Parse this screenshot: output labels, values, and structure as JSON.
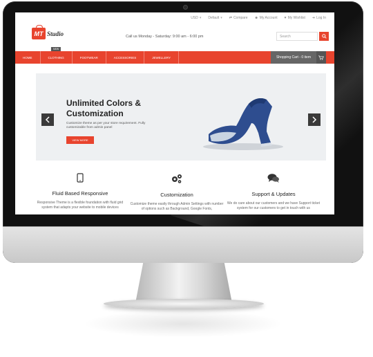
{
  "topbar": {
    "currency": "USD",
    "store": "Default",
    "links": [
      "Compare",
      "My Account",
      "My Wishlist",
      "Log In"
    ]
  },
  "header": {
    "logo_mark": "MT",
    "logo_text": "Studio",
    "callus": "Call us Monday - Saturday: 9:00 am - 6:00 pm",
    "search_placeholder": "Search"
  },
  "nav": {
    "items": [
      "HOME",
      "CLOTHING",
      "FOOTWEAR",
      "ACCESSORIES",
      "JEWELLERY"
    ],
    "badge": "NEW",
    "cart_label": "Shopping Cart - 0 item"
  },
  "hero": {
    "title": "Unlimited Colors & Customization",
    "text": "Customize theme as per your store requirement. Fully customizable from admin panel",
    "button": "VIEW MORE"
  },
  "features": [
    {
      "title": "Fluid Based Responsive",
      "text": "Responsive Theme is a flexible foundation with fluid grid system that adapts your website to mobile devices"
    },
    {
      "title": "Customization",
      "text": "Customize theme easily through Admin Settings with number of options such as Background, Google Fonts,"
    },
    {
      "title": "Support & Updates",
      "text": "We do care about our customers and we have Support ticket system for our customers to get in touch with us"
    }
  ],
  "colors": {
    "accent": "#e8442e",
    "dark": "#3a3a3a"
  }
}
